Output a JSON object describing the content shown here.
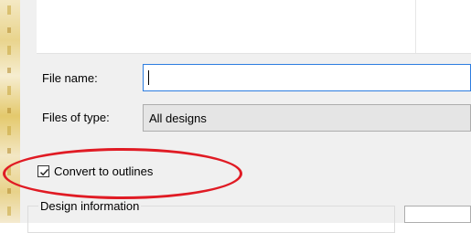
{
  "form": {
    "file_name_label": "File name:",
    "file_name_value": "",
    "files_of_type_label": "Files of type:",
    "files_of_type_value": "All designs",
    "convert_outlines_label": "Convert to outlines",
    "convert_outlines_checked": true,
    "design_info_label": "Design information"
  },
  "colors": {
    "highlight": "#e01b24",
    "focus": "#2d7de0"
  }
}
